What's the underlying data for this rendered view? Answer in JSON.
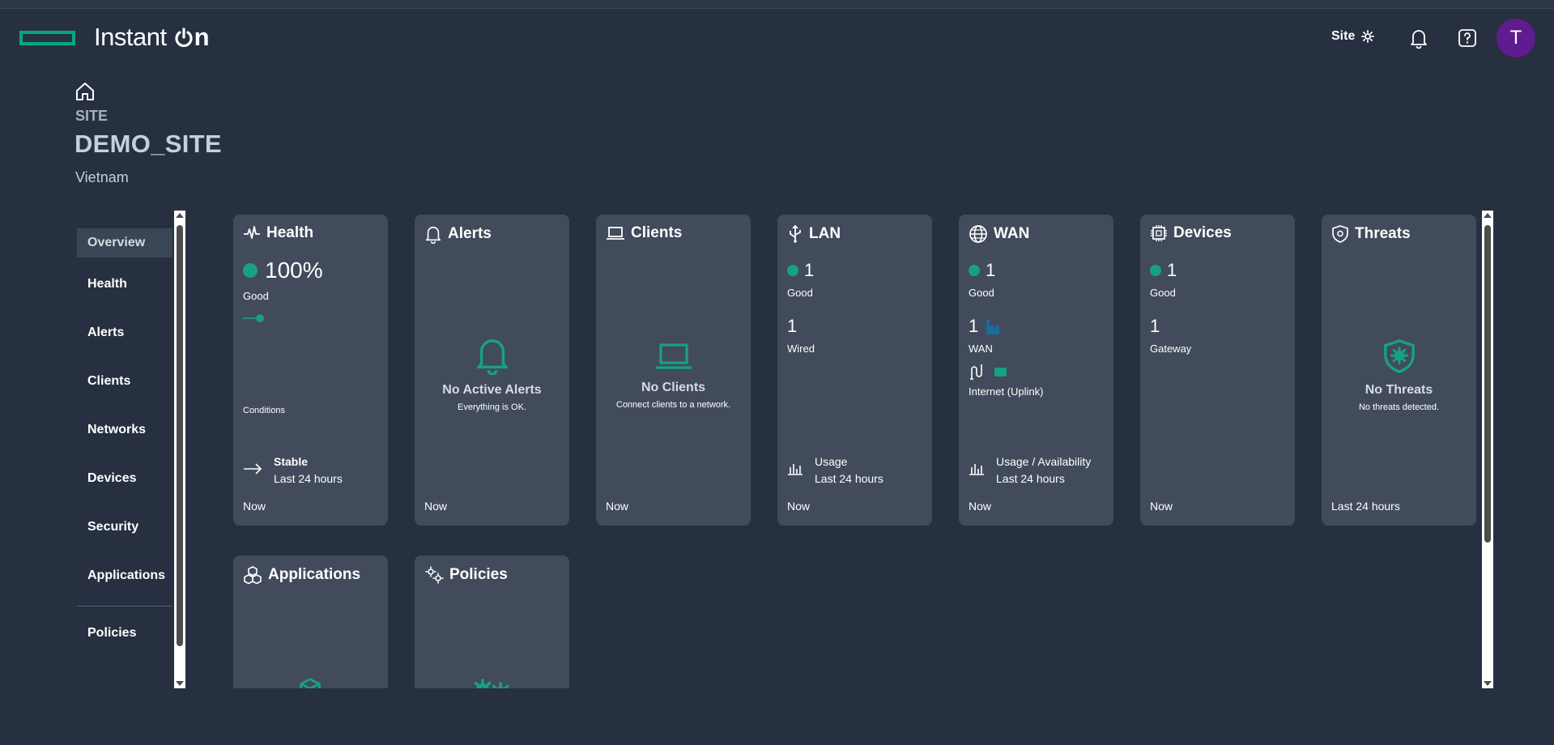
{
  "header": {
    "brand_text": "Instant",
    "brand_on": "on",
    "site_button": "Site",
    "avatar_initial": "T"
  },
  "page": {
    "label": "SITE",
    "site_name": "DEMO_SITE",
    "country": "Vietnam"
  },
  "sidebar": {
    "items": [
      {
        "label": "Overview",
        "active": true
      },
      {
        "label": "Health"
      },
      {
        "label": "Alerts"
      },
      {
        "label": "Clients"
      },
      {
        "label": "Networks"
      },
      {
        "label": "Devices"
      },
      {
        "label": "Security"
      },
      {
        "label": "Applications"
      },
      {
        "label": "Policies"
      }
    ]
  },
  "cards": {
    "health": {
      "title": "Health",
      "percent": "100%",
      "status": "Good",
      "conditions_label": "Conditions",
      "trend_title": "Stable",
      "trend_period": "Last 24 hours",
      "footer": "Now"
    },
    "alerts": {
      "title": "Alerts",
      "empty_title": "No Active Alerts",
      "empty_sub": "Everything is OK.",
      "footer": "Now"
    },
    "clients": {
      "title": "Clients",
      "empty_title": "No Clients",
      "empty_sub": "Connect clients to a network.",
      "footer": "Now"
    },
    "lan": {
      "title": "LAN",
      "good_count": "1",
      "good_label": "Good",
      "wired_count": "1",
      "wired_label": "Wired",
      "usage_title": "Usage",
      "usage_period": "Last 24 hours",
      "footer": "Now"
    },
    "wan": {
      "title": "WAN",
      "good_count": "1",
      "good_label": "Good",
      "wan_count": "1",
      "wan_label": "WAN",
      "uplink_label": "Internet (Uplink)",
      "usage_title": "Usage / Availability",
      "usage_period": "Last 24 hours",
      "footer": "Now"
    },
    "devices": {
      "title": "Devices",
      "good_count": "1",
      "good_label": "Good",
      "gateway_count": "1",
      "gateway_label": "Gateway",
      "footer": "Now"
    },
    "threats": {
      "title": "Threats",
      "empty_title": "No Threats",
      "empty_sub": "No threats detected.",
      "footer": "Last 24 hours"
    },
    "applications": {
      "title": "Applications"
    },
    "policies": {
      "title": "Policies"
    }
  },
  "colors": {
    "background": "#263040",
    "card": "#414b5b",
    "accent_green": "#01a982",
    "status_good": "#17a085",
    "avatar": "#5e1c8f"
  }
}
